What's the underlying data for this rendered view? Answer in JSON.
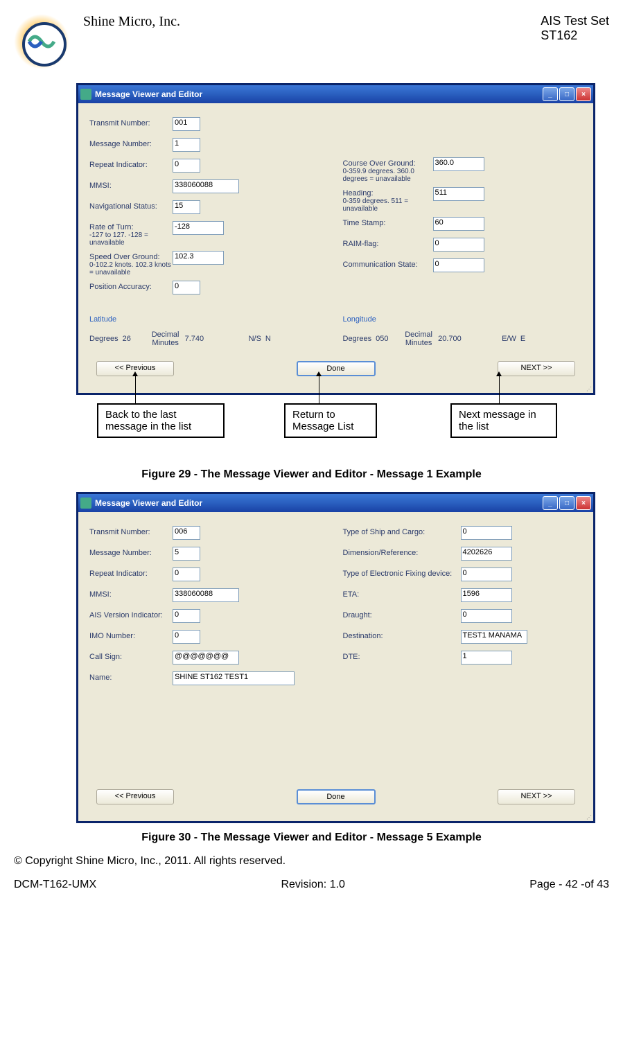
{
  "header": {
    "company": "Shine Micro, Inc.",
    "product_line1": "AIS Test Set",
    "product_line2": "ST162"
  },
  "win_title": "Message Viewer and Editor",
  "fig1": {
    "left": [
      {
        "label": "Transmit Number:",
        "value": "001",
        "w": "fw-s",
        "sel": true
      },
      {
        "label": "Message Number:",
        "value": "1",
        "w": "fw-s",
        "ro": true
      },
      {
        "label": " Repeat Indicator:",
        "value": "0",
        "w": "fw-s"
      },
      {
        "label": "MMSI:",
        "value": "338060088",
        "w": "fw-l"
      },
      {
        "label": "Navigational Status:",
        "value": "15",
        "w": "fw-s"
      },
      {
        "label": "Rate of Turn:",
        "sub": "-127 to 127. -128 = unavailable",
        "value": "-128",
        "w": "fw-m"
      },
      {
        "label": "Speed Over Ground:",
        "sub": "0-102.2 knots. 102.3 knots = unavailable",
        "value": "102.3",
        "w": "fw-m"
      },
      {
        "label": "Position Accuracy:",
        "value": "0",
        "w": "fw-s"
      }
    ],
    "right": [
      {
        "label": "Course Over Ground:",
        "sub": "0-359.9 degrees. 360.0 degrees = unavailable",
        "value": "360.0",
        "w": "fw-m"
      },
      {
        "label": "Heading:",
        "sub": "0-359 degrees. 511 = unavailable",
        "value": "511",
        "w": "fw-m"
      },
      {
        "label": "Time Stamp:",
        "value": "60",
        "w": "fw-m"
      },
      {
        "label": "RAIM-flag:",
        "value": "0",
        "w": "fw-m"
      },
      {
        "label": "Communication State:",
        "value": "0",
        "w": "fw-m"
      }
    ],
    "lat": {
      "title": "Latitude",
      "deg_l": "Degrees",
      "deg_v": "26",
      "min_l": "Decimal Minutes",
      "min_v": "7.740",
      "ns_l": "N/S",
      "ns_v": "N"
    },
    "lon": {
      "title": "Longitude",
      "deg_l": "Degrees",
      "deg_v": "050",
      "min_l": "Decimal Minutes",
      "min_v": "20.700",
      "ew_l": "E/W",
      "ew_v": "E"
    },
    "buttons": {
      "prev": "<< Previous",
      "done": "Done",
      "next": "NEXT >>"
    }
  },
  "callouts": {
    "c1": "Back to the last message in the list",
    "c2": "Return to Message List",
    "c3": "Next message in the list"
  },
  "cap1": "Figure 29 - The Message Viewer and Editor - Message 1 Example",
  "fig2": {
    "left": [
      {
        "label": "Transmit Number:",
        "value": "006",
        "w": "fw-s",
        "sel": true
      },
      {
        "label": "Message Number:",
        "value": "5",
        "w": "fw-s",
        "ro": true
      },
      {
        "label": " Repeat Indicator:",
        "value": "0",
        "w": "fw-s"
      },
      {
        "label": "MMSI:",
        "value": "338060088",
        "w": "fw-l"
      },
      {
        "label": "AIS Version Indicator:",
        "value": "0",
        "w": "fw-s"
      },
      {
        "label": "IMO Number:",
        "value": "0",
        "w": "fw-s"
      },
      {
        "label": "Call Sign:",
        "value": "@@@@@@@",
        "w": "fw-l"
      },
      {
        "label": "Name:",
        "value": "SHINE ST162 TEST1",
        "w": "fw-xl"
      }
    ],
    "right": [
      {
        "label": "Type of Ship and Cargo:",
        "value": "0",
        "w": "fw-m"
      },
      {
        "label": "Dimension/Reference:",
        "value": "4202626",
        "w": "fw-m"
      },
      {
        "label": "Type of Electronic Fixing device:",
        "value": "0",
        "w": "fw-m"
      },
      {
        "label": "ETA:",
        "value": "1596",
        "w": "fw-m"
      },
      {
        "label": "Draught:",
        "value": "0",
        "w": "fw-m"
      },
      {
        "label": "Destination:",
        "value": "TEST1 MANAMA",
        "w": "fw-l"
      },
      {
        "label": "DTE:",
        "value": "1",
        "w": "fw-m"
      }
    ],
    "buttons": {
      "prev": "<< Previous",
      "done": "Done",
      "next": "NEXT >>"
    }
  },
  "cap2": "Figure 30 - The Message Viewer and Editor - Message 5 Example",
  "footer": {
    "copyright": "© Copyright Shine Micro, Inc., 2011.  All rights reserved.",
    "doc": "DCM-T162-UMX",
    "rev": "Revision: 1.0",
    "page": "Page - 42 -of 43"
  }
}
